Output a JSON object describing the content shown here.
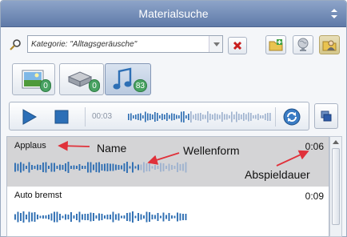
{
  "window": {
    "title": "Materialsuche"
  },
  "search": {
    "placeholder": "Kategorie: \"Alltagsgeräusche\"",
    "value": "Kategorie: \"Alltagsgeräusche\""
  },
  "tabs": [
    {
      "name": "images",
      "count": "0"
    },
    {
      "name": "books",
      "count": "0"
    },
    {
      "name": "sounds",
      "count": "83",
      "active": true
    }
  ],
  "player": {
    "time": "00:03"
  },
  "items": [
    {
      "name": "Applaus",
      "duration": "0:06",
      "selected": true
    },
    {
      "name": "Auto bremst",
      "duration": "0:09",
      "selected": false
    }
  ],
  "annotations": {
    "name": "Name",
    "waveform": "Wellenform",
    "duration": "Abspieldauer"
  },
  "colors": {
    "accent": "#5f7aa8",
    "annotation_arrow": "#e0313a",
    "waveform": "#2f6fb3",
    "badge": "#48a262"
  }
}
